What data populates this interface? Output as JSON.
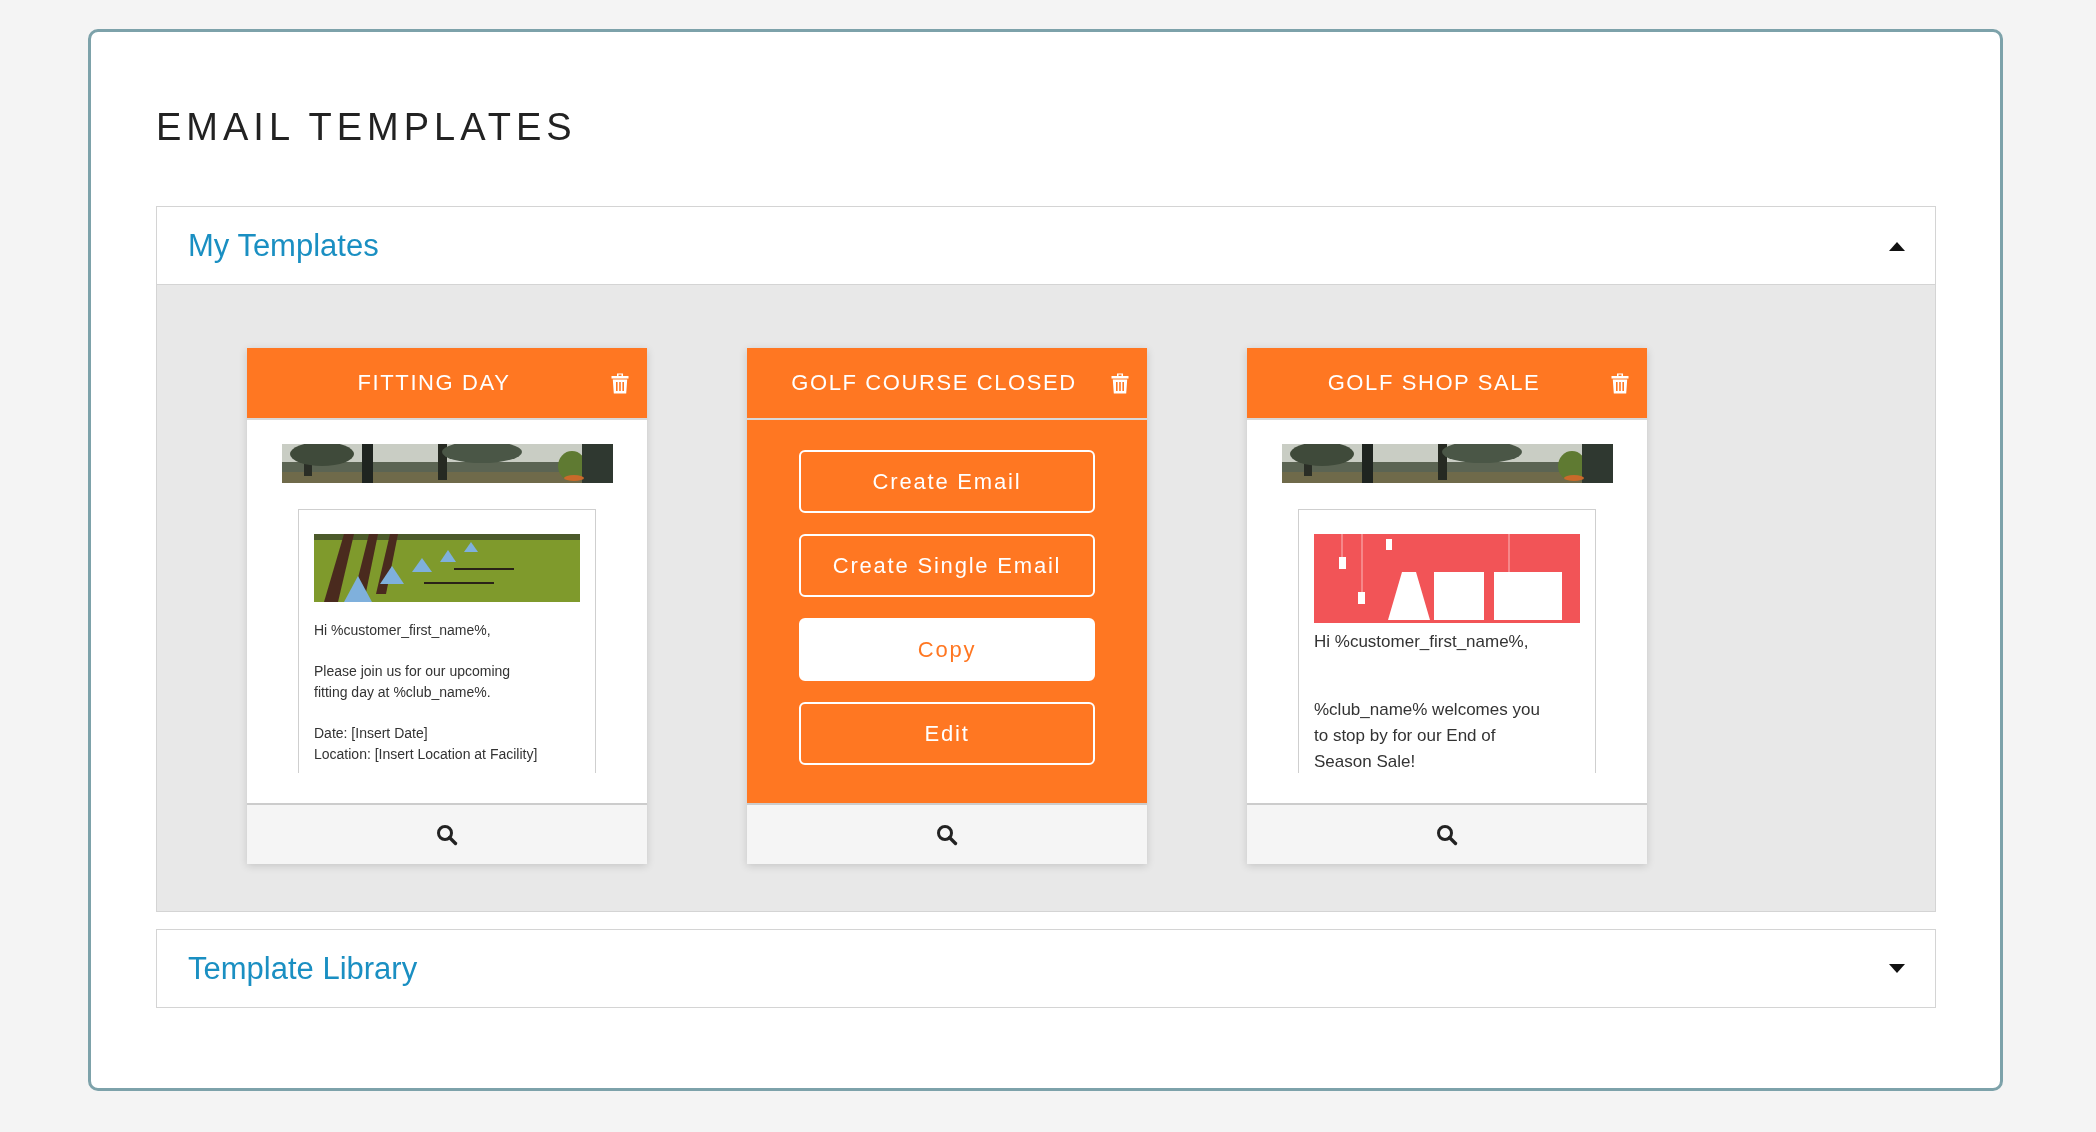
{
  "page": {
    "title": "EMAIL TEMPLATES"
  },
  "sections": [
    {
      "title": "My Templates",
      "expanded": true,
      "cards": [
        {
          "title": "FITTING DAY",
          "kind": "preview",
          "paragraphs": [
            [
              "Hi %customer_first_name%,"
            ],
            [
              "Please join us for our upcoming",
              "fitting day at %club_name%."
            ],
            [
              "Date: [Insert Date]",
              "Location: [Insert Location at Facility]"
            ]
          ]
        },
        {
          "title": "GOLF COURSE CLOSED",
          "kind": "actions",
          "buttons": [
            {
              "label": "Create Email",
              "selected": false
            },
            {
              "label": "Create Single Email",
              "selected": false
            },
            {
              "label": "Copy",
              "selected": true
            },
            {
              "label": "Edit",
              "selected": false
            }
          ]
        },
        {
          "title": "GOLF SHOP SALE",
          "kind": "preview",
          "paragraphs": [
            [
              "Hi %customer_first_name%,"
            ],
            [
              "%club_name% welcomes you",
              "to stop by for our End of",
              "Season Sale!"
            ]
          ]
        }
      ]
    },
    {
      "title": "Template Library",
      "expanded": false
    }
  ]
}
